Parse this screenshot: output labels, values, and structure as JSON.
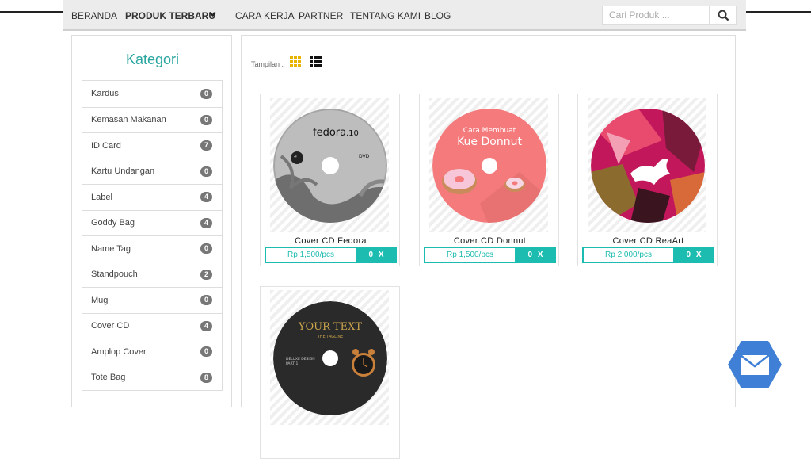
{
  "nav": {
    "items": [
      "BERANDA",
      "PRODUK TERBARU",
      "CARA KERJA",
      "PARTNER",
      "TENTANG KAMI",
      "BLOG"
    ],
    "search_placeholder": "Cari Produk ..."
  },
  "sidebar": {
    "title": "Kategori",
    "categories": [
      {
        "label": "Kardus",
        "count": "0"
      },
      {
        "label": "Kemasan Makanan",
        "count": "0"
      },
      {
        "label": "ID Card",
        "count": "7"
      },
      {
        "label": "Kartu Undangan",
        "count": "0"
      },
      {
        "label": "Label",
        "count": "4"
      },
      {
        "label": "Goddy Bag",
        "count": "4"
      },
      {
        "label": "Name Tag",
        "count": "0"
      },
      {
        "label": "Standpouch",
        "count": "2"
      },
      {
        "label": "Mug",
        "count": "0"
      },
      {
        "label": "Cover CD",
        "count": "4"
      },
      {
        "label": "Amplop Cover",
        "count": "0"
      },
      {
        "label": "Tote Bag",
        "count": "8"
      }
    ]
  },
  "main": {
    "view_label": "Tampilan :",
    "products": [
      {
        "title": "Cover CD Fedora",
        "price": "Rp 1,500/pcs",
        "qty": "0 X",
        "disc_text": [
          "fedora",
          ".10",
          "DVD"
        ]
      },
      {
        "title": "Cover CD Donnut",
        "price": "Rp 1,500/pcs",
        "qty": "0 X",
        "disc_text": [
          "Cara Membuat",
          "Kue Donnut"
        ]
      },
      {
        "title": "Cover CD ReaArt",
        "price": "Rp 2,000/pcs",
        "qty": "0 X",
        "disc_text": []
      },
      {
        "title": "",
        "price": "",
        "qty": "",
        "disc_text": [
          "YOUR TEXT",
          "THE TAGLINE",
          "DELUXE DESIGN",
          "PART 1"
        ]
      }
    ]
  },
  "colors": {
    "accent": "#1dbcb0",
    "title": "#2aa6a0",
    "grid_icon": "#e8b400",
    "mail_button": "#3f7fd6"
  },
  "icons": [
    "search-icon",
    "chevron-down-icon",
    "grid-view-icon",
    "list-view-icon",
    "mail-icon"
  ]
}
